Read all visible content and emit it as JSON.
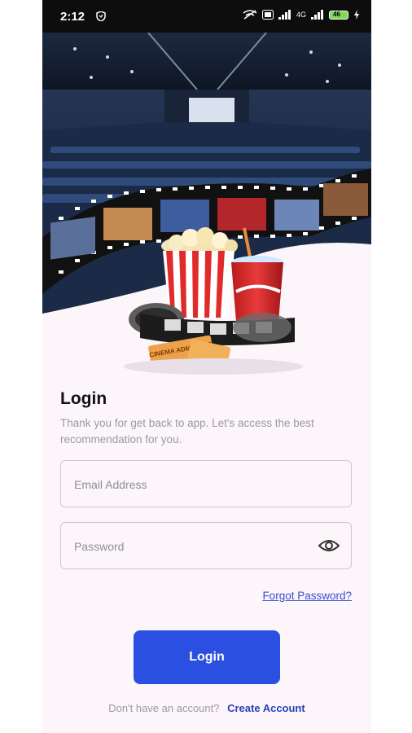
{
  "status_bar": {
    "time": "2:12",
    "network_label": "4G",
    "battery_level": "46",
    "icons": [
      "shield-icon",
      "wifi-calling-icon",
      "signal-icon",
      "volte-icon",
      "battery-icon",
      "charging-icon"
    ]
  },
  "hero": {
    "image": "cinema-hall-with-filmstrip-popcorn-drink-tickets",
    "ticket_text": "CINEMA ADMIT ONE"
  },
  "login": {
    "title": "Login",
    "subtitle": "Thank you for get back to app. Let's access the best recommendation for you.",
    "email_placeholder": "Email Address",
    "email_value": "",
    "password_placeholder": "Password",
    "password_value": "",
    "forgot_label": "Forgot Password?",
    "button_label": "Login",
    "signup_prompt": "Don't have an account?",
    "create_account_label": "Create Account"
  },
  "colors": {
    "accent": "#2b4fe0",
    "link": "#3a4bd0",
    "background": "#fcf6fb"
  }
}
